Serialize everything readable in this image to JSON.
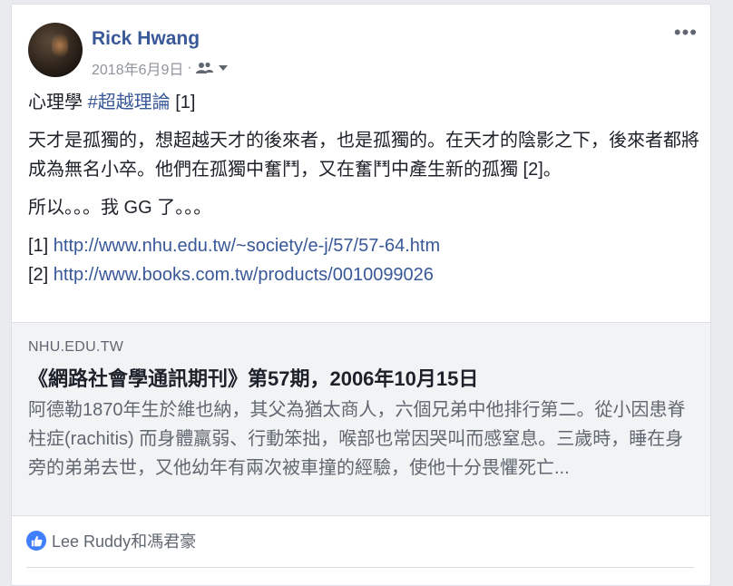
{
  "post": {
    "author": "Rick Hwang",
    "date": "2018年6月9日",
    "meta_separator": "·",
    "audience_icon": "friends-icon",
    "menu_glyph": "•••",
    "lines": {
      "l1_prefix": "心理學 ",
      "l1_hashtag": "#超越理論",
      "l1_suffix": " [1]",
      "l2": "天才是孤獨的，想超越天才的後來者，也是孤獨的。在天才的陰影之下，後來者都將成為無名小卒。他們在孤獨中奮鬥，又在奮鬥中產生新的孤獨 [2]。",
      "l3": "所以。。。我 GG 了。。。",
      "ref1_label": "[1] ",
      "ref1_url": "http://www.nhu.edu.tw/~society/e-j/57/57-64.htm",
      "ref2_label": "[2] ",
      "ref2_url": "http://www.books.com.tw/products/0010099026"
    }
  },
  "link_preview": {
    "domain": "NHU.EDU.TW",
    "title": "《網路社會學通訊期刊》第57期，2006年10月15日",
    "description": "阿德勒1870年生於維也納，其父為猶太商人，六個兄弟中他排行第二。從小因患脊柱症(rachitis) 而身體羸弱、行動笨拙，喉部也常因哭叫而感窒息。三歲時，睡在身旁的弟弟去世，又他幼年有兩次被車撞的經驗，使他十分畏懼死亡..."
  },
  "reactions": {
    "icon": "like-icon",
    "text": "Lee Ruddy和馮君豪"
  },
  "colors": {
    "link": "#385898",
    "like_badge": "#4080ff"
  }
}
